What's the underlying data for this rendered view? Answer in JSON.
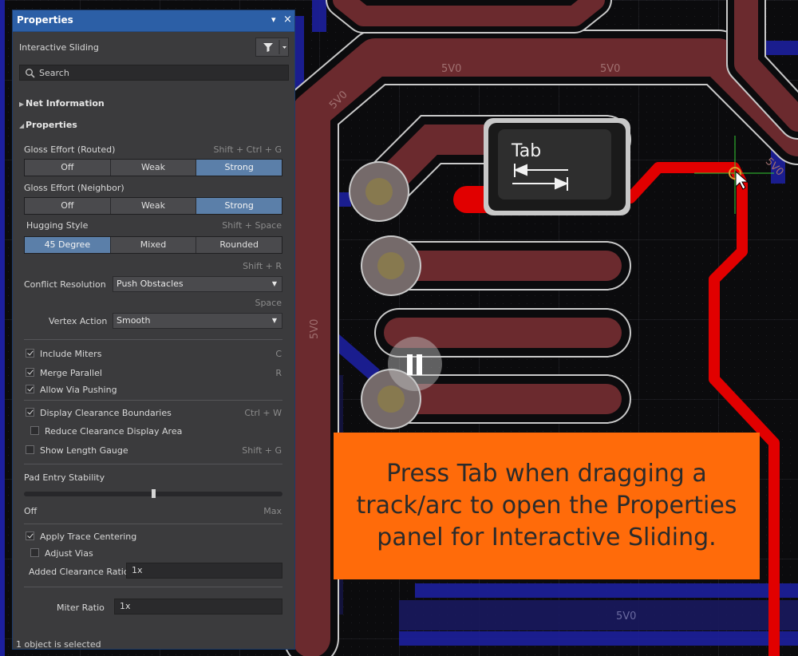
{
  "colors": {
    "accent": "#2c5fa6",
    "selected": "#5b7fa9",
    "track": "#e10000",
    "callout": "#ff6b0a"
  },
  "panel": {
    "title": "Properties",
    "menu_glyph": "▾",
    "close_glyph": "×",
    "mode": "Interactive Sliding",
    "search_placeholder": "Search",
    "net_info": "Net Information",
    "properties": "Properties",
    "gloss_routed": {
      "label": "Gloss Effort (Routed)",
      "hint": "Shift + Ctrl + G",
      "options": [
        "Off",
        "Weak",
        "Strong"
      ],
      "selected": "Strong"
    },
    "gloss_neighbor": {
      "label": "Gloss Effort (Neighbor)",
      "options": [
        "Off",
        "Weak",
        "Strong"
      ],
      "selected": "Strong"
    },
    "hugging": {
      "label": "Hugging Style",
      "hint": "Shift + Space",
      "options": [
        "45 Degree",
        "Mixed",
        "Rounded"
      ],
      "selected": "45 Degree"
    },
    "conflict": {
      "hint": "Shift + R",
      "label": "Conflict Resolution",
      "value": "Push Obstacles"
    },
    "vertex": {
      "hint": "Space",
      "label": "Vertex Action",
      "value": "Smooth"
    },
    "checks": [
      {
        "label": "Include Miters",
        "hint": "C",
        "checked": true
      },
      {
        "label": "Merge Parallel",
        "hint": "R",
        "checked": true
      },
      {
        "label": "Allow Via Pushing",
        "hint": "",
        "checked": true
      },
      {
        "label": "Display Clearance Boundaries",
        "hint": "Ctrl + W",
        "checked": true
      },
      {
        "label": "Reduce Clearance Display Area",
        "hint": "",
        "checked": false
      },
      {
        "label": "Show Length Gauge",
        "hint": "Shift + G",
        "checked": false
      }
    ],
    "pad_entry": {
      "label": "Pad Entry Stability",
      "min": "Off",
      "max": "Max",
      "level": 0.5
    },
    "trace": [
      {
        "label": "Apply Trace Centering",
        "checked": true
      },
      {
        "label": "Adjust Vias",
        "checked": false
      }
    ],
    "added_clearance": {
      "label": "Added Clearance Ratio",
      "value": "1x"
    },
    "miter_ratio": {
      "label": "Miter Ratio",
      "value": "1x"
    },
    "status": "1 object is selected"
  },
  "pcb": {
    "net_labels": [
      "5V0",
      "5V0",
      "5V0",
      "5V0",
      "5V0",
      "5V0"
    ],
    "key_label": "Tab"
  },
  "callout": "Press Tab when dragging a track/arc to open the Properties panel for Interactive Sliding."
}
